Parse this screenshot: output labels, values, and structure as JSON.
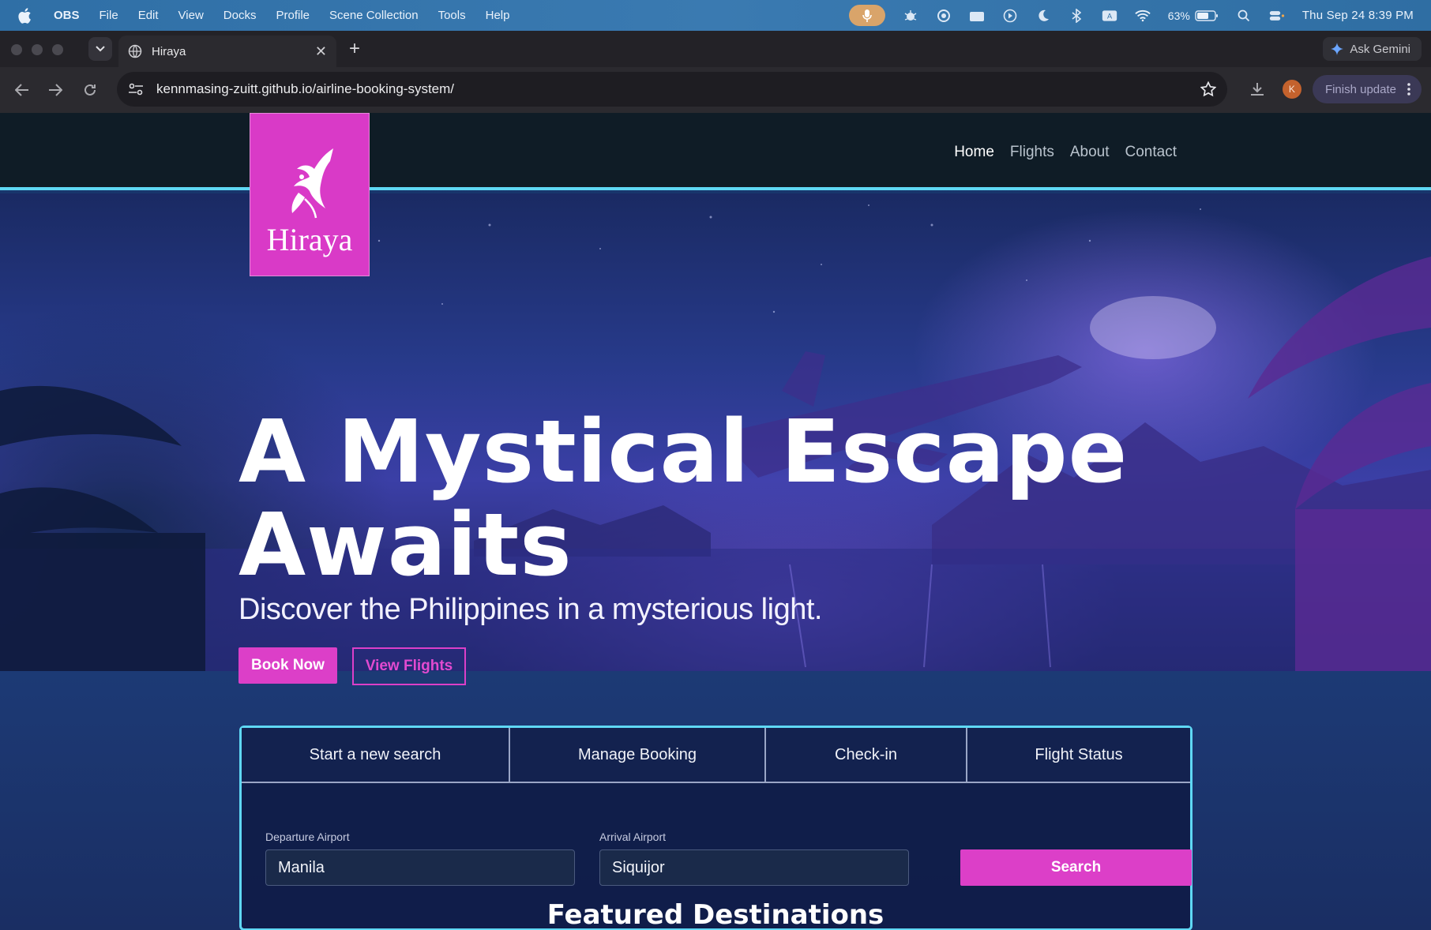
{
  "menubar": {
    "app_name": "OBS",
    "items": [
      "File",
      "Edit",
      "View",
      "Docks",
      "Profile",
      "Scene Collection",
      "Tools",
      "Help"
    ],
    "battery": "63%",
    "clock": "Thu Sep 24  8:39 PM"
  },
  "browser": {
    "tab_title": "Hiraya",
    "url": "kennmasing-zuitt.github.io/airline-booking-system/",
    "gemini_label": "Ask Gemini",
    "profile_initial": "K",
    "finish_update_label": "Finish update"
  },
  "site": {
    "logo_text": "Hiraya",
    "nav": [
      "Home",
      "Flights",
      "About",
      "Contact"
    ],
    "hero": {
      "title_line1": "A Mystical Escape",
      "title_line2": "Awaits",
      "subtitle": "Discover the Philippines in a mysterious light.",
      "book_now": "Book Now",
      "view_flights": "View Flights"
    },
    "search_panel": {
      "tabs": [
        "Start a new search",
        "Manage Booking",
        "Check-in",
        "Flight Status"
      ],
      "departure_label": "Departure Airport",
      "departure_value": "Manila",
      "arrival_label": "Arrival Airport",
      "arrival_value": "Siquijor",
      "search_label": "Search"
    },
    "featured_heading": "Featured Destinations"
  },
  "colors": {
    "accent_pink": "#dc3fc8",
    "accent_cyan": "#5fd8f4",
    "navbar_bg": "#0f1c26"
  }
}
